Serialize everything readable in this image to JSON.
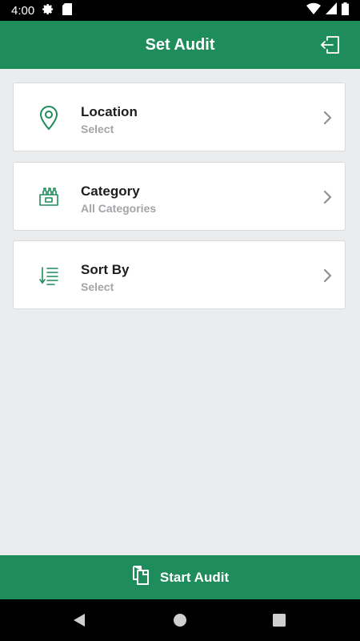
{
  "status_bar": {
    "time": "4:00",
    "icons": [
      "settings-icon",
      "sd-card-icon",
      "wifi-icon",
      "signal-icon",
      "battery-icon"
    ]
  },
  "app_bar": {
    "title": "Set Audit",
    "action_icon": "logout-icon"
  },
  "filters": [
    {
      "title": "Location",
      "value": "Select",
      "icon": "location-pin-icon"
    },
    {
      "title": "Category",
      "value": "All Categories",
      "icon": "bottle-crate-icon"
    },
    {
      "title": "Sort By",
      "value": "Select",
      "icon": "sort-list-icon"
    }
  ],
  "bottom_button": {
    "label": "Start Audit",
    "icon": "clipboard-copy-icon"
  },
  "nav_bar": {
    "icons": [
      "back-icon",
      "home-icon",
      "recents-icon"
    ]
  },
  "colors": {
    "primary": "#1f8c5b",
    "background": "#ebecee",
    "card": "#ffffff",
    "subtext": "#a3a5a8"
  }
}
